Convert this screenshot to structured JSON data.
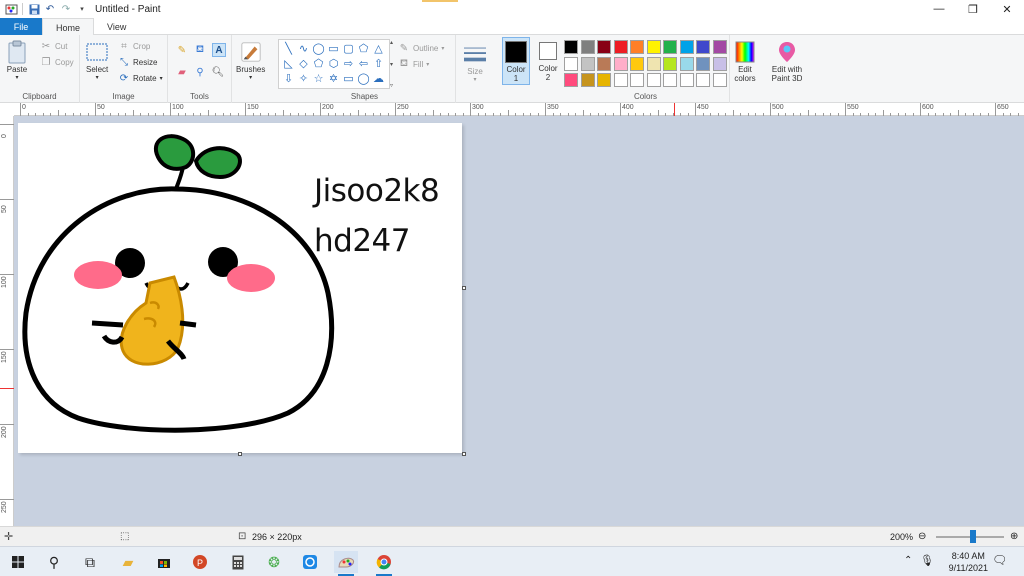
{
  "window": {
    "title": "Untitled - Paint",
    "qat_icons": [
      "save-icon",
      "undo-icon",
      "redo-icon",
      "customize-icon"
    ]
  },
  "tabs": [
    {
      "label": "File"
    },
    {
      "label": "Home"
    },
    {
      "label": "View"
    }
  ],
  "ribbon": {
    "clipboard": {
      "label": "Clipboard",
      "paste": "Paste",
      "cut": "Cut",
      "copy": "Copy"
    },
    "image": {
      "label": "Image",
      "select": "Select",
      "crop": "Crop",
      "resize": "Resize",
      "rotate": "Rotate"
    },
    "tools": {
      "label": "Tools"
    },
    "brushes": {
      "label": "Brushes"
    },
    "shapes": {
      "label": "Shapes",
      "outline": "Outline",
      "fill": "Fill"
    },
    "size": {
      "label": "Size"
    },
    "color1": {
      "label": "Color",
      "sub": "1",
      "value": "#000000"
    },
    "color2": {
      "label": "Color",
      "sub": "2",
      "value": "#ffffff"
    },
    "colors": {
      "label": "Colors"
    },
    "edit_colors": {
      "line1": "Edit",
      "line2": "colors"
    },
    "paint3d": {
      "line1": "Edit with",
      "line2": "Paint 3D"
    }
  },
  "palette": {
    "row1": [
      "#000000",
      "#7f7f7f",
      "#880015",
      "#ed1c24",
      "#ff7f27",
      "#fff200",
      "#22b14c",
      "#00a2e8",
      "#3f48cc",
      "#a349a4"
    ],
    "row2": [
      "#ffffff",
      "#c3c3c3",
      "#b97a57",
      "#ffaec9",
      "#ffc90e",
      "#efe4b0",
      "#b5e61d",
      "#99d9ea",
      "#7092be",
      "#c8bfe7"
    ],
    "row3": [
      "#ff4b7d",
      "#c6941e",
      "#e6b400",
      "#ffffff",
      "#ffffff",
      "#ffffff",
      "#ffffff",
      "#ffffff",
      "#ffffff",
      "#ffffff"
    ]
  },
  "ruler": {
    "top_labels": [
      "0",
      "50",
      "100",
      "150",
      "200",
      "250",
      "300",
      "350",
      "400",
      "450",
      "500",
      "550",
      "600",
      "650"
    ],
    "left_labels": [
      "0",
      "50",
      "100",
      "150",
      "200",
      "250"
    ]
  },
  "canvas": {
    "text_line1": "Jisoo2k8",
    "text_line2": "hd247"
  },
  "status": {
    "dimensions": "296 × 220px",
    "zoom": "200%"
  },
  "taskbar": {
    "time": "8:40 AM",
    "date": "9/11/2021"
  }
}
